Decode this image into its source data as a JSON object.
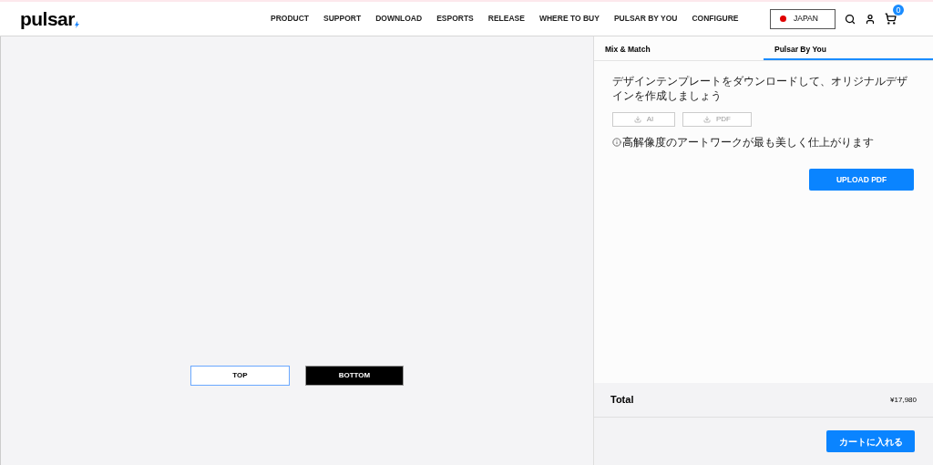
{
  "header": {
    "logo": "pulsar",
    "nav": [
      "PRODUCT",
      "SUPPORT",
      "DOWNLOAD",
      "ESPORTS",
      "RELEASE",
      "WHERE TO BUY",
      "PULSAR BY YOU",
      "CONFIGURE"
    ],
    "country": {
      "label": "JAPAN",
      "color": "#e00000"
    },
    "cart_count": "0"
  },
  "views": [
    {
      "label": "TOP",
      "selected": true
    },
    {
      "label": "BOTTOM",
      "selected": false
    }
  ],
  "tabs": [
    {
      "label": "Mix & Match",
      "selected": false
    },
    {
      "label": "Pulsar By You",
      "selected": true
    }
  ],
  "panel": {
    "instruction": "デザインテンプレートをダウンロードして、オリジナルデザインを作成しましょう",
    "downloads": [
      "AI",
      "PDF"
    ],
    "notice": "高解像度のアートワークが最も美しく仕上がります",
    "upload": "UPLOAD PDF"
  },
  "total": {
    "label": "Total",
    "value": "¥17,980"
  },
  "cart_button": "カートに入れる"
}
